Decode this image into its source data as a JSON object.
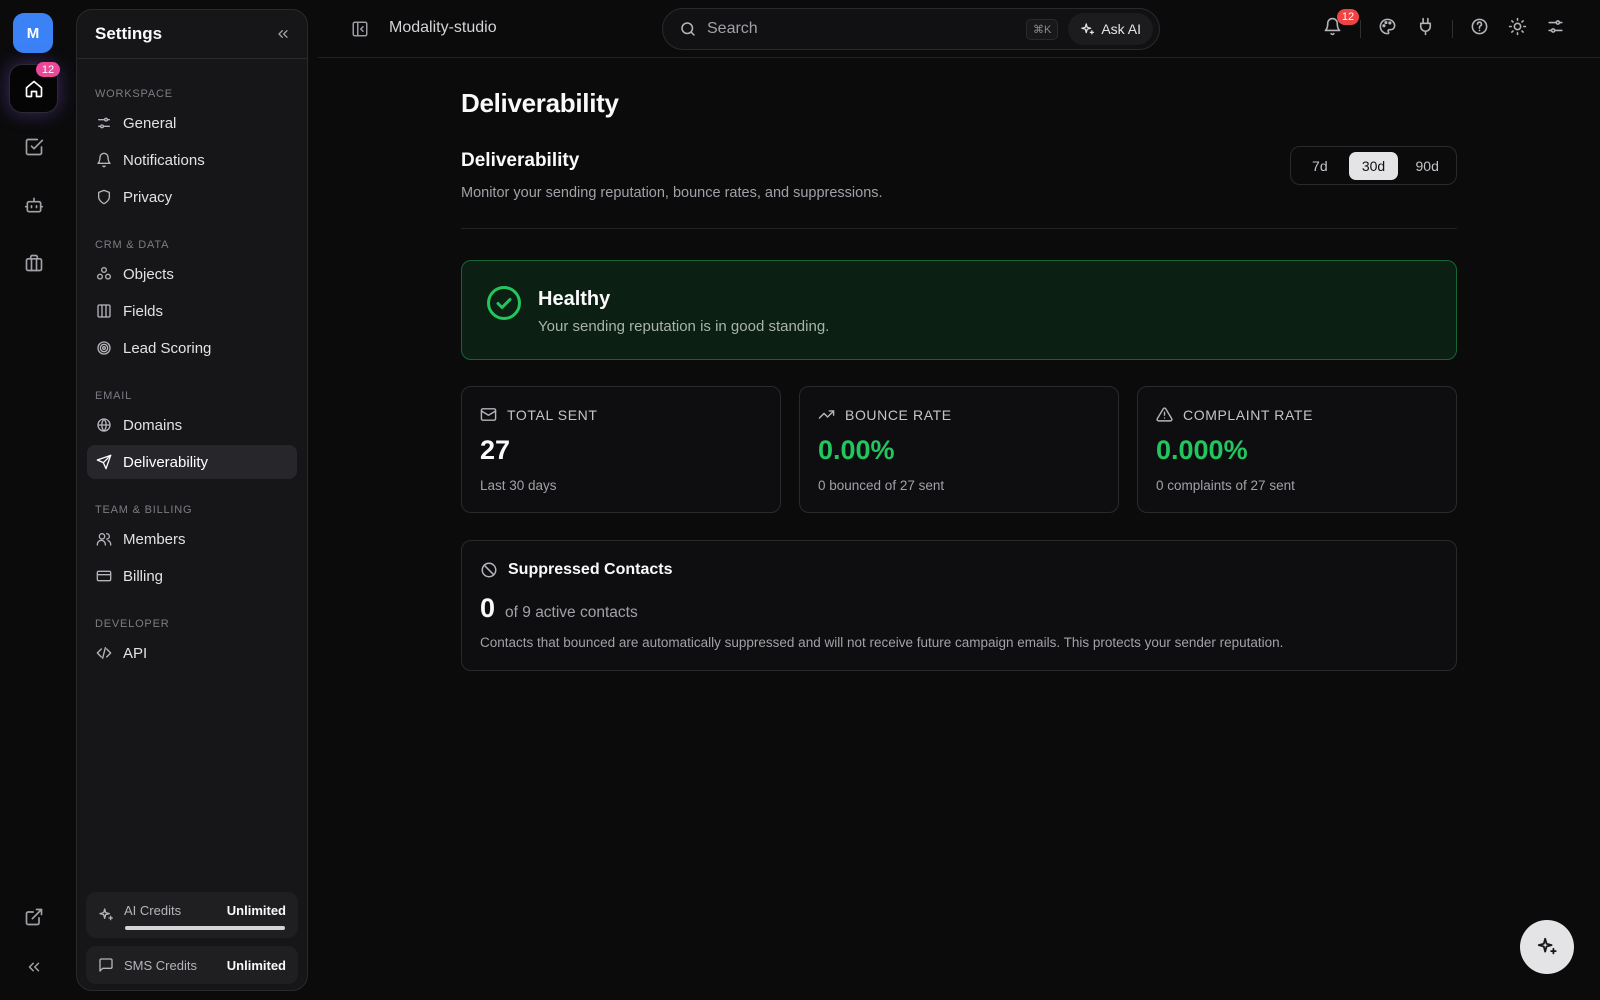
{
  "user": {
    "initial": "M"
  },
  "rail": {
    "home_badge": "12"
  },
  "settings_panel": {
    "title": "Settings",
    "sections": [
      {
        "label": "WORKSPACE",
        "items": [
          "General",
          "Notifications",
          "Privacy"
        ]
      },
      {
        "label": "CRM & DATA",
        "items": [
          "Objects",
          "Fields",
          "Lead Scoring"
        ]
      },
      {
        "label": "EMAIL",
        "items": [
          "Domains",
          "Deliverability"
        ]
      },
      {
        "label": "TEAM & BILLING",
        "items": [
          "Members",
          "Billing"
        ]
      },
      {
        "label": "DEVELOPER",
        "items": [
          "API"
        ]
      }
    ],
    "active_item": "Deliverability",
    "ai_credits": {
      "label": "AI Credits",
      "value": "Unlimited"
    },
    "sms_credits": {
      "label": "SMS Credits",
      "value": "Unlimited"
    }
  },
  "topbar": {
    "workspace": "Modality-studio",
    "search_placeholder": "Search",
    "shortcut": "⌘K",
    "ask_ai": "Ask AI",
    "notification_count": "12"
  },
  "page": {
    "title": "Deliverability",
    "section_title": "Deliverability",
    "section_desc": "Monitor your sending reputation, bounce rates, and suppressions.",
    "ranges": [
      "7d",
      "30d",
      "90d"
    ],
    "selected_range": "30d"
  },
  "health": {
    "status": "Healthy",
    "message": "Your sending reputation is in good standing."
  },
  "stats": {
    "total_sent": {
      "label": "TOTAL SENT",
      "value": "27",
      "sub": "Last 30 days"
    },
    "bounce_rate": {
      "label": "BOUNCE RATE",
      "value": "0.00%",
      "sub": "0 bounced of 27 sent"
    },
    "complaint_rate": {
      "label": "COMPLAINT RATE",
      "value": "0.000%",
      "sub": "0 complaints of 27 sent"
    }
  },
  "suppressed": {
    "title": "Suppressed Contacts",
    "count": "0",
    "of_text": "of 9 active contacts",
    "desc": "Contacts that bounced are automatically suppressed and will not receive future campaign emails. This protects your sender reputation."
  },
  "colors": {
    "accent_green": "#22c55e",
    "avatar_blue": "#3b82f6",
    "badge_pink": "#ec4899",
    "badge_red": "#ef4444"
  }
}
